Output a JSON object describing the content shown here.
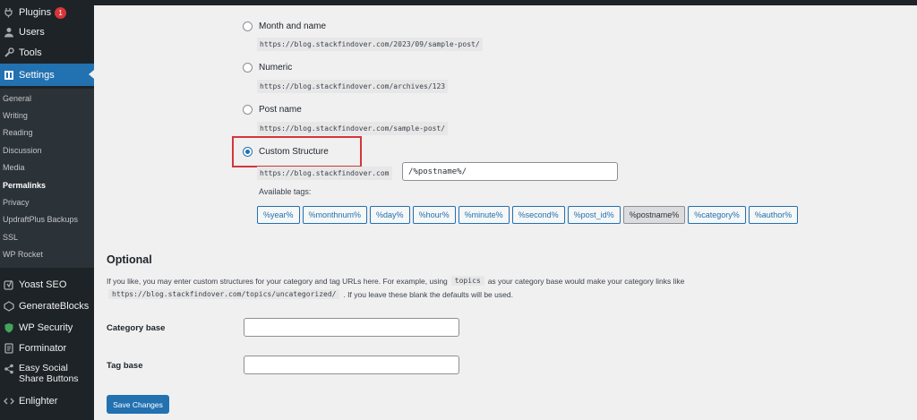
{
  "sidebar": {
    "top_menu": [
      {
        "label": "Plugins",
        "icon": "plugins-icon",
        "badge": "1"
      },
      {
        "label": "Users",
        "icon": "users-icon"
      },
      {
        "label": "Tools",
        "icon": "tools-icon"
      },
      {
        "label": "Settings",
        "icon": "settings-icon",
        "active": true
      }
    ],
    "submenu": [
      "General",
      "Writing",
      "Reading",
      "Discussion",
      "Media",
      "Permalinks",
      "Privacy",
      "UpdraftPlus Backups",
      "SSL",
      "WP Rocket"
    ],
    "submenu_current": "Permalinks",
    "bottom_menu": [
      {
        "label": "Yoast SEO",
        "icon": "yoast-icon"
      },
      {
        "label": "GenerateBlocks",
        "icon": "generateblocks-icon"
      },
      {
        "label": "WP Security",
        "icon": "shield-icon"
      },
      {
        "label": "Forminator",
        "icon": "forminator-icon"
      },
      {
        "label": "Easy Social Share Buttons",
        "icon": "share-icon"
      },
      {
        "label": "Enlighter",
        "icon": "code-icon"
      }
    ]
  },
  "permalink_options": [
    {
      "label": "Month and name",
      "example": "https://blog.stackfindover.com/2023/09/sample-post/",
      "checked": false
    },
    {
      "label": "Numeric",
      "example": "https://blog.stackfindover.com/archives/123",
      "checked": false
    },
    {
      "label": "Post name",
      "example": "https://blog.stackfindover.com/sample-post/",
      "checked": false
    },
    {
      "label": "Custom Structure",
      "checked": true
    }
  ],
  "custom_structure": {
    "prefix": "https://blog.stackfindover.com",
    "value": "/%postname%/",
    "available_tags_label": "Available tags:",
    "tags": [
      "%year%",
      "%monthnum%",
      "%day%",
      "%hour%",
      "%minute%",
      "%second%",
      "%post_id%",
      "%postname%",
      "%category%",
      "%author%"
    ],
    "active_tag": "%postname%"
  },
  "optional": {
    "title": "Optional",
    "desc_part1": "If you like, you may enter custom structures for your category and tag URLs here. For example, using",
    "desc_code1": "topics",
    "desc_part2": "as your category base would make your category links like",
    "desc_code2": "https://blog.stackfindover.com/topics/uncategorized/",
    "desc_part3": ". If you leave these blank the defaults will be used.",
    "category_base_label": "Category base",
    "category_base_value": "",
    "tag_base_label": "Tag base",
    "tag_base_value": ""
  },
  "save_button": "Save Changes",
  "colors": {
    "accent": "#2271b1",
    "sidebar_bg": "#1d2327",
    "highlight": "#d63638"
  }
}
